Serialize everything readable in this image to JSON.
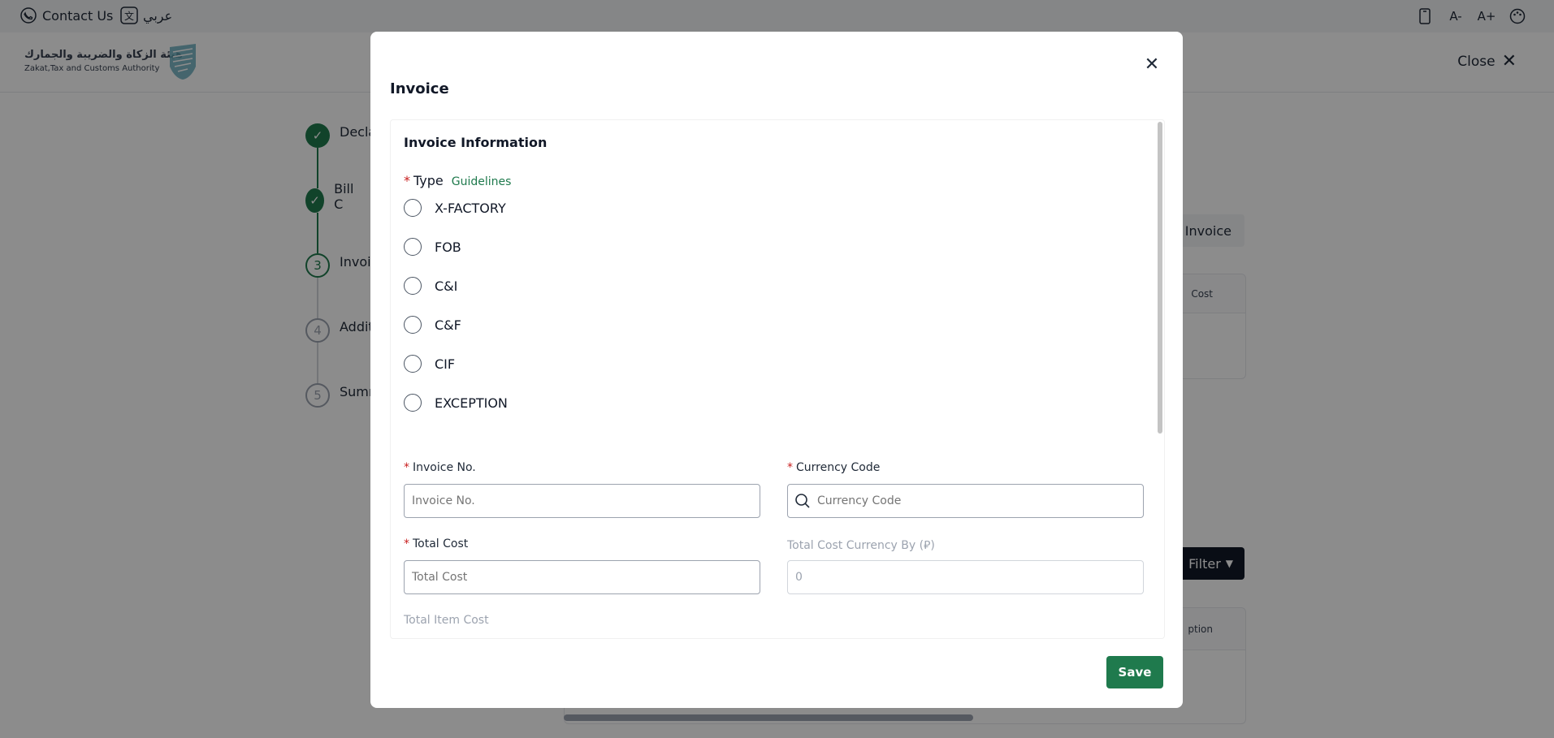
{
  "topbar": {
    "contact_label": "Contact Us",
    "language_label": "عربي",
    "font_decrease": "A-",
    "font_increase": "A+"
  },
  "header": {
    "logo_ar": "هيئة الزكاة والضريبة والجمارك",
    "logo_en": "Zakat,Tax and Customs Authority",
    "close_label": "Close"
  },
  "stepper": {
    "steps": [
      {
        "number": "1",
        "label": "Decla",
        "state": "done"
      },
      {
        "number": "2",
        "label": "Bill C",
        "state": "done"
      },
      {
        "number": "3",
        "label": "Invoi",
        "state": "current"
      },
      {
        "number": "4",
        "label": "Additi",
        "state": "todo"
      },
      {
        "number": "5",
        "label": "Summ",
        "state": "todo"
      }
    ]
  },
  "background": {
    "add_invoice_button": "l Invoice",
    "table_header_cost": "Cost",
    "filter_button": "Filter",
    "table_header_option": "ption"
  },
  "modal": {
    "title": "Invoice",
    "section_title": "Invoice Information",
    "type_label": "Type",
    "required_mark": "*",
    "guidelines_link": "Guidelines",
    "type_options": [
      "X-FACTORY",
      "FOB",
      "C&I",
      "C&F",
      "CIF",
      "EXCEPTION"
    ],
    "invoice_no": {
      "label": "Invoice No.",
      "placeholder": "Invoice No.",
      "value": ""
    },
    "currency_code": {
      "label": "Currency Code",
      "placeholder": "Currency Code",
      "value": ""
    },
    "total_cost": {
      "label": "Total Cost",
      "placeholder": "Total Cost",
      "value": ""
    },
    "total_cost_currency": {
      "label": "Total Cost Currency By (⃁)",
      "value": "0"
    },
    "total_item_cost": {
      "label": "Total Item Cost"
    },
    "save_label": "Save"
  },
  "colors": {
    "brand_green": "#1f7a4d",
    "required_red": "#c81e1e",
    "filter_dark": "#111827"
  }
}
